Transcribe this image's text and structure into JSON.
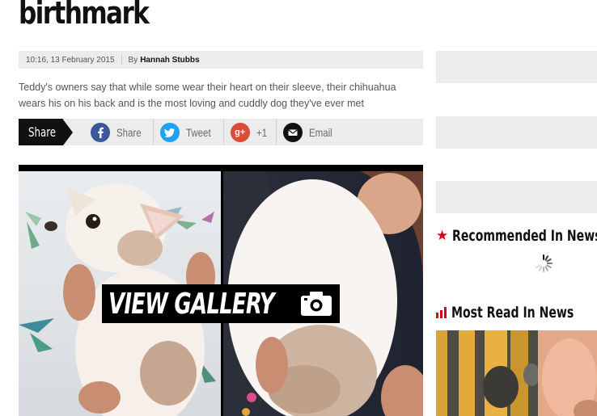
{
  "article": {
    "headline_tail": "birthmark",
    "timestamp": "10:16, 13 February 2015",
    "byline_prefix": "By",
    "author": "Hannah Stubbs",
    "standfirst": "Teddy's owners say that while some wear their heart on their sleeve, their chihuahua wears his on his back and is the most loving and cuddly dog they've ever met"
  },
  "share": {
    "label": "Share",
    "items": [
      {
        "icon": "facebook-icon",
        "label": "Share",
        "color": "#3b5998"
      },
      {
        "icon": "twitter-icon",
        "label": "Tweet",
        "color": "#1da1f2"
      },
      {
        "icon": "google-plus-icon",
        "glyph": "g+",
        "label": "+1",
        "color": "#dd4b39"
      },
      {
        "icon": "email-icon",
        "label": "Email",
        "color": "#111111"
      }
    ]
  },
  "gallery": {
    "button_label": "VIEW GALLERY",
    "icon": "camera-icon"
  },
  "sidebar": {
    "recommended_heading": "Recommended In News",
    "recommended_icon": "star-icon",
    "loading_icon": "loading-spinner-icon",
    "most_read_heading": "Most Read In News",
    "most_read_icon": "bar-chart-icon"
  },
  "colors": {
    "accent_red": "#d8001b",
    "bar_grey": "#ececec",
    "text_dark": "#111111"
  }
}
